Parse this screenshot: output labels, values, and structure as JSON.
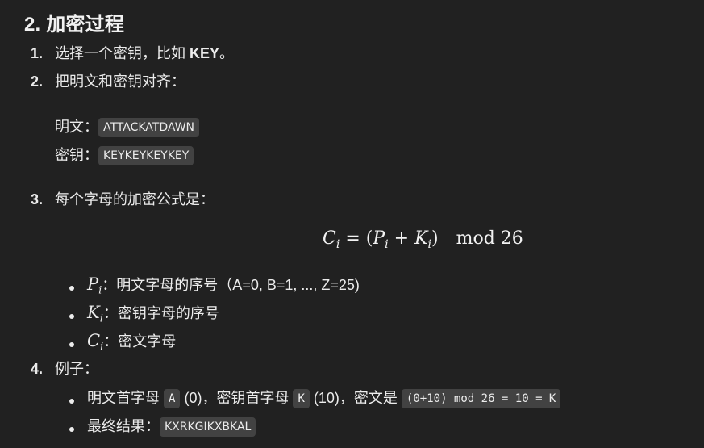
{
  "heading": "2. 加密过程",
  "steps": [
    {
      "num": "1.",
      "text_before": "选择一个密钥，比如 ",
      "bold": "KEY",
      "text_after": "。"
    },
    {
      "num": "2.",
      "text": "把明文和密钥对齐："
    },
    {
      "num": "3.",
      "text": "每个字母的加密公式是："
    },
    {
      "num": "4.",
      "text": "例子："
    }
  ],
  "alignment": {
    "plain_label": "明文：",
    "plain_value": "ATTACKATDAWN",
    "key_label": "密钥：",
    "key_value": "KEYKEYKEYKEY"
  },
  "formula": {
    "lhs": "C",
    "lhs_sub": "i",
    "eq": "=",
    "open": "(",
    "p": "P",
    "p_sub": "i",
    "plus": "+",
    "k": "K",
    "k_sub": "i",
    "close": ")",
    "mod": "mod 26"
  },
  "definitions": [
    {
      "var": "P",
      "sub": "i",
      "text": "：明文字母的序号（A=0, B=1, ..., Z=25)"
    },
    {
      "var": "K",
      "sub": "i",
      "text": "：密钥字母的序号"
    },
    {
      "var": "C",
      "sub": "i",
      "text": "：密文字母"
    }
  ],
  "example": {
    "t1": "明文首字母 ",
    "c1": "A",
    "t2": " (0)，密钥首字母 ",
    "c2": "K",
    "t3": " (10)，密文是 ",
    "c3": "(0+10) mod 26 = 10 = K",
    "result_label": "最终结果：",
    "result_value": "KXRKGIKXBKAL"
  }
}
